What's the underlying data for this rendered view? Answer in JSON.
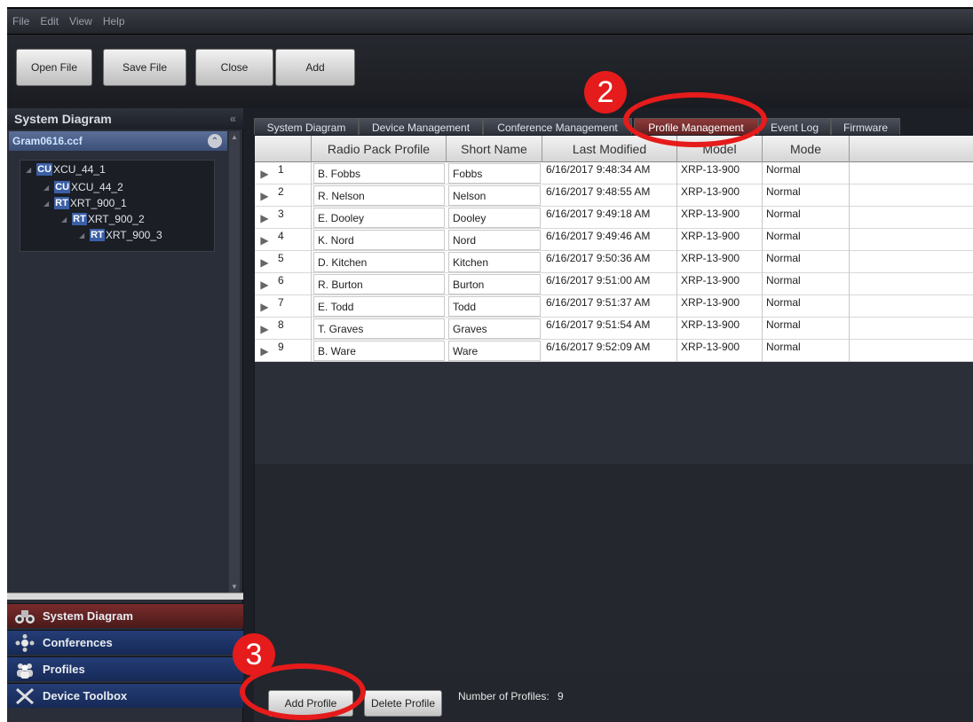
{
  "menu": [
    "File",
    "Edit",
    "View",
    "Help"
  ],
  "toolbar": {
    "open_label": "Open File",
    "save_label": "Save File",
    "close_label": "Close",
    "add_label": "Add"
  },
  "left_panel": {
    "title": "System Diagram",
    "file": "Gram0616.ccf",
    "tree": [
      {
        "badge": "CU",
        "label": "XCU_44_1"
      },
      {
        "badge": "CU",
        "label": "XCU_44_2"
      },
      {
        "badge": "RT",
        "label": "XRT_900_1"
      },
      {
        "badge": "RT",
        "label": "XRT_900_2"
      },
      {
        "badge": "RT",
        "label": "XRT_900_3"
      }
    ],
    "nav": [
      {
        "label": "System Diagram",
        "icon": "binoculars-icon"
      },
      {
        "label": "Conferences",
        "icon": "conference-icon"
      },
      {
        "label": "Profiles",
        "icon": "people-icon"
      },
      {
        "label": "Device Toolbox",
        "icon": "tools-icon"
      }
    ]
  },
  "tabs": [
    "System Diagram",
    "Device Management",
    "Conference Management",
    "Profile Management",
    "Event Log",
    "Firmware"
  ],
  "active_tab": "Profile Management",
  "grid": {
    "columns": [
      "Radio Pack Profile",
      "Short Name",
      "Last Modified",
      "Model",
      "Mode"
    ],
    "rows": [
      {
        "n": "1",
        "profile": "B. Fobbs",
        "short": "Fobbs",
        "modified": "6/16/2017 9:48:34 AM",
        "model": "XRP-13-900",
        "mode": "Normal"
      },
      {
        "n": "2",
        "profile": "R. Nelson",
        "short": "Nelson",
        "modified": "6/16/2017 9:48:55 AM",
        "model": "XRP-13-900",
        "mode": "Normal"
      },
      {
        "n": "3",
        "profile": "E. Dooley",
        "short": "Dooley",
        "modified": "6/16/2017 9:49:18 AM",
        "model": "XRP-13-900",
        "mode": "Normal"
      },
      {
        "n": "4",
        "profile": "K. Nord",
        "short": "Nord",
        "modified": "6/16/2017 9:49:46 AM",
        "model": "XRP-13-900",
        "mode": "Normal"
      },
      {
        "n": "5",
        "profile": "D. Kitchen",
        "short": "Kitchen",
        "modified": "6/16/2017 9:50:36 AM",
        "model": "XRP-13-900",
        "mode": "Normal"
      },
      {
        "n": "6",
        "profile": "R. Burton",
        "short": "Burton",
        "modified": "6/16/2017 9:51:00 AM",
        "model": "XRP-13-900",
        "mode": "Normal"
      },
      {
        "n": "7",
        "profile": "E. Todd",
        "short": "Todd",
        "modified": "6/16/2017 9:51:37 AM",
        "model": "XRP-13-900",
        "mode": "Normal"
      },
      {
        "n": "8",
        "profile": "T. Graves",
        "short": "Graves",
        "modified": "6/16/2017 9:51:54 AM",
        "model": "XRP-13-900",
        "mode": "Normal"
      },
      {
        "n": "9",
        "profile": "B. Ware",
        "short": "Ware",
        "modified": "6/16/2017 9:52:09 AM",
        "model": "XRP-13-900",
        "mode": "Normal"
      }
    ]
  },
  "bottom": {
    "add_label": "Add Profile",
    "delete_label": "Delete Profile",
    "count_label": "Number of Profiles:",
    "count": "9"
  },
  "annotations": {
    "step2": "2",
    "step3": "3",
    "color": "#e61b1b"
  }
}
